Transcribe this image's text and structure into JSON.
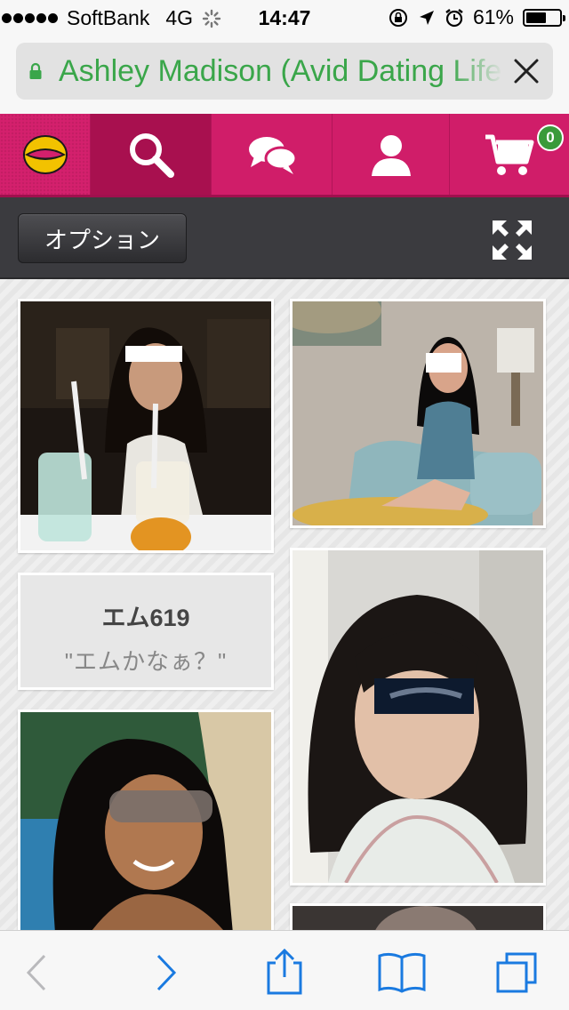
{
  "status_bar": {
    "carrier": "SoftBank",
    "network": "4G",
    "time": "14:47",
    "battery": "61%",
    "battery_level": 0.61
  },
  "browser": {
    "page_title": "Ashley Madison (Avid Dating Life"
  },
  "nav": {
    "tabs": [
      "logo",
      "search",
      "messages",
      "profile",
      "cart"
    ],
    "cart_count": "0",
    "accent_color": "#d01d69"
  },
  "options": {
    "button_label": "オプション"
  },
  "profiles": [
    {
      "name": "エム619",
      "quote": "\"エムかなぁ？\""
    }
  ],
  "toolbar": {
    "icons": [
      "back-icon",
      "forward-icon",
      "share-icon",
      "bookmarks-icon",
      "tabs-icon"
    ]
  }
}
